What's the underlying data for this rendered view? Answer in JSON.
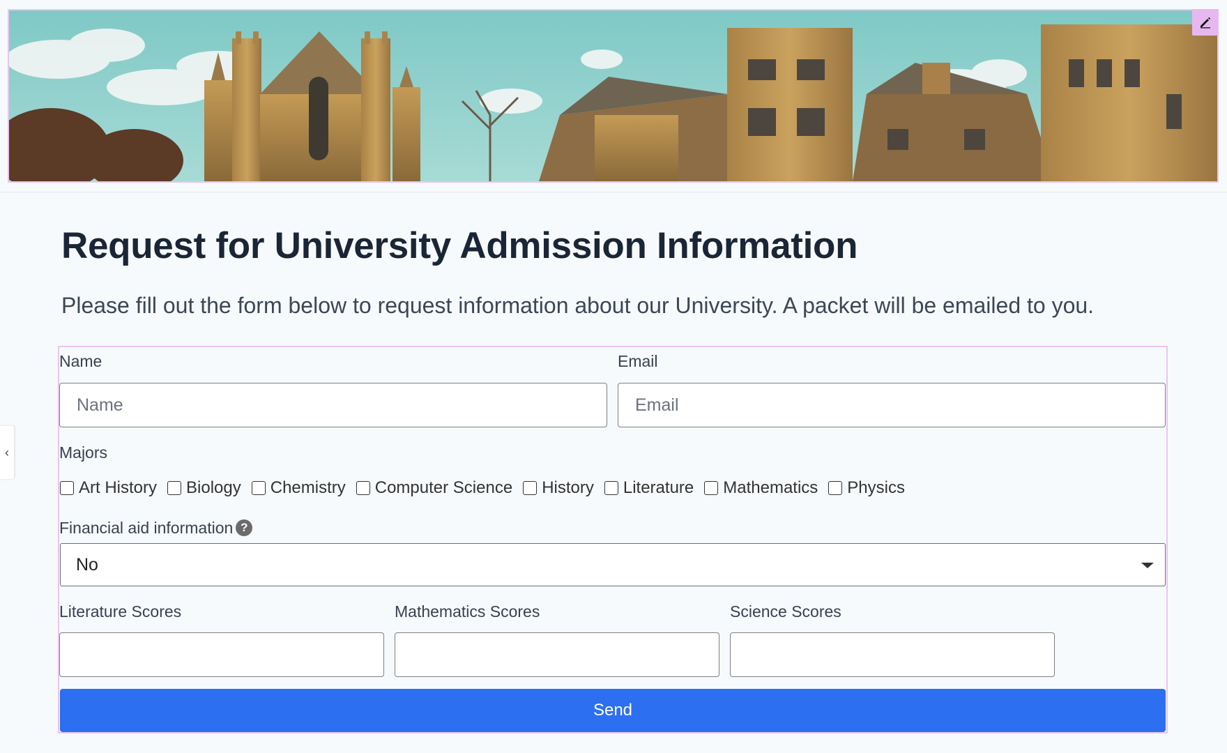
{
  "banner": {
    "edit_icon": "pencil-icon",
    "colors": {
      "sky": "#8fcfcc",
      "stone": "#b38a4e"
    }
  },
  "side_tab": {
    "icon": "chevron-left-icon",
    "glyph": "‹"
  },
  "page": {
    "title": "Request for University Admission Information",
    "subtitle": "Please fill out the form below to request information about our University. A packet will be emailed to you."
  },
  "form": {
    "name": {
      "label": "Name",
      "placeholder": "Name",
      "value": ""
    },
    "email": {
      "label": "Email",
      "placeholder": "Email",
      "value": ""
    },
    "majors": {
      "label": "Majors",
      "options": [
        "Art History",
        "Biology",
        "Chemistry",
        "Computer Science",
        "History",
        "Literature",
        "Mathematics",
        "Physics"
      ]
    },
    "financial_aid": {
      "label": "Financial aid information",
      "help_glyph": "?",
      "selected": "No"
    },
    "scores": {
      "literature": {
        "label": "Literature Scores",
        "value": ""
      },
      "mathematics": {
        "label": "Mathematics Scores",
        "value": ""
      },
      "science": {
        "label": "Science Scores",
        "value": ""
      }
    },
    "submit_label": "Send"
  },
  "colors": {
    "accent": "#2c6ff0",
    "form_border": "#ebc4f1",
    "edit_button": "#e7b8f0"
  }
}
